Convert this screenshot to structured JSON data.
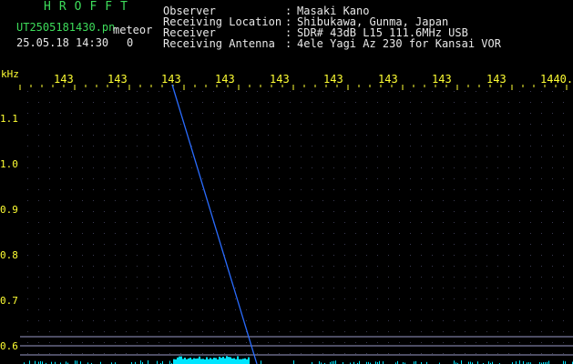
{
  "header": {
    "app_title": "HROFFT",
    "filename": "UT2505181430.pn",
    "mode_label": "meteor",
    "datetime": "25.05.18 14:30",
    "count": "0",
    "info": [
      {
        "label": "Observer",
        "value": "Masaki Kano"
      },
      {
        "label": "Receiving Location",
        "value": "Shibukawa, Gunma, Japan"
      },
      {
        "label": "Receiver",
        "value": "SDR# 43dB L15 111.6MHz USB"
      },
      {
        "label": "Receiving Antenna",
        "value": "4ele Yagi Az 230 for Kansai VOR"
      }
    ],
    "separator": ":"
  },
  "axis": {
    "unit": "kHz",
    "y_ticks": [
      "1.1",
      "1.0",
      "0.9",
      "0.8",
      "0.7",
      "0.6"
    ],
    "x_ticks": [
      "143",
      "143",
      "143",
      "143",
      "143",
      "143",
      "143",
      "143",
      "143",
      "1440."
    ]
  },
  "colors": {
    "background": "#000000",
    "grid": "#3a3a52",
    "trace": "#2a6cff",
    "reference_line": "#9a9ac8",
    "noise": "#00e5ff",
    "label": "#ffff33",
    "title": "#3ddc5a"
  }
}
